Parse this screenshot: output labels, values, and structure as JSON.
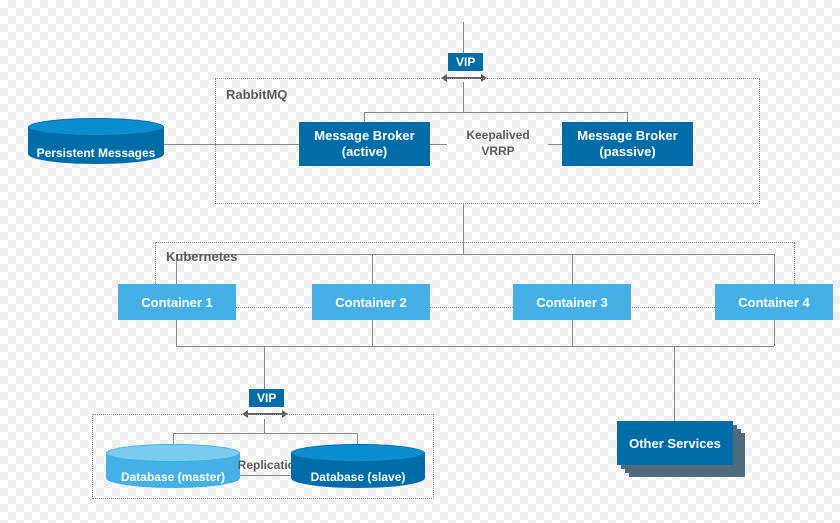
{
  "vip_top": "VIP",
  "vip_db": "VIP",
  "rabbitmq": {
    "title": "RabbitMQ",
    "broker_active_l1": "Message Broker",
    "broker_active_l2": "(active)",
    "broker_passive_l1": "Message Broker",
    "broker_passive_l2": "(passive)",
    "keepalived": "Keepalived",
    "vrrp": "VRRP"
  },
  "persistent_messages": "Persistent Messages",
  "kubernetes": {
    "title": "Kubernetes",
    "c1": "Container 1",
    "c2": "Container 2",
    "c3": "Container 3",
    "c4": "Container 4"
  },
  "db": {
    "master": "Database (master)",
    "slave": "Database (slave)",
    "replication": "Replication"
  },
  "other_services": "Other Services"
}
